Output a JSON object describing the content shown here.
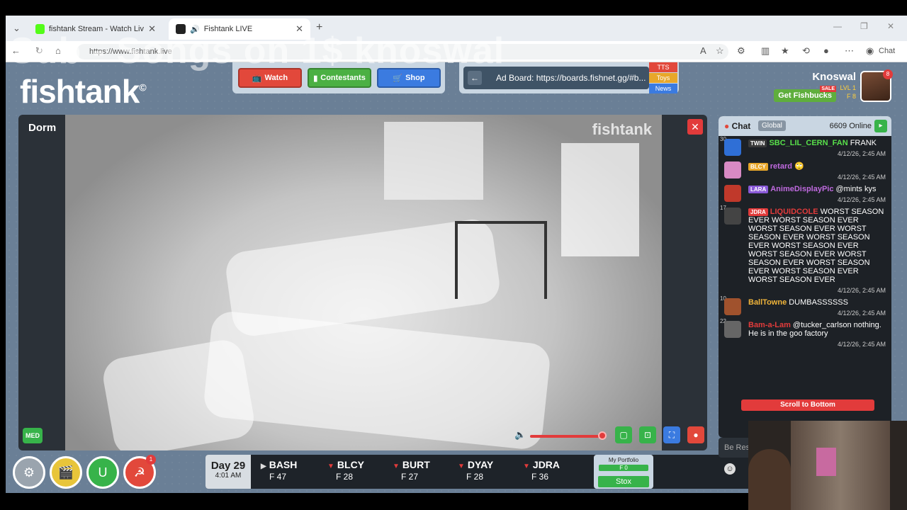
{
  "browser": {
    "tabs": [
      {
        "title": "fishtank Stream - Watch Live on K",
        "favicon_color": "#53fc18",
        "active": false
      },
      {
        "title": "Fishtank LIVE",
        "favicon_color": "#222222",
        "active": true
      }
    ],
    "new_tab_label": "+",
    "url": "https://www.fishtank.live",
    "copilot_label": "Chat"
  },
  "overlay_text": "Sub - Songs on 1$ knoswal",
  "app": {
    "logo": "fishtank",
    "logo_mark": "©",
    "nav": {
      "watch": "Watch",
      "contestants": "Contestants",
      "shop": "Shop"
    },
    "ad_board": "Ad Board: https://boards.fishnet.gg/#b...",
    "ad_tabs": [
      "TTS",
      "Toys",
      "News"
    ],
    "user": {
      "name": "Knoswal",
      "fishbucks_label": "Get Fishbucks",
      "sale_label": "SALE",
      "level": "LVL 1",
      "balance": "F 8",
      "notifications": "8"
    },
    "video": {
      "room": "Dorm",
      "watermark": "fishtank",
      "quality": "MED",
      "close": "✕",
      "volume_level": 0.95
    },
    "bottom_buttons": [
      {
        "name": "settings",
        "color": "#9aa4ae",
        "glyph": "⚙"
      },
      {
        "name": "clapper",
        "color": "#e8c53a",
        "glyph": "🎬"
      },
      {
        "name": "magnet",
        "color": "#37b34a",
        "glyph": "U"
      },
      {
        "name": "hammer-sickle",
        "color": "#e2483b",
        "glyph": "☭",
        "badge": "1"
      }
    ],
    "day": {
      "label": "Day 29",
      "time": "4:01 AM"
    },
    "contestants": [
      {
        "name": "BASH",
        "score": "F 47",
        "trend": "up"
      },
      {
        "name": "BLCY",
        "score": "F 28",
        "trend": "down"
      },
      {
        "name": "BURT",
        "score": "F 27",
        "trend": "down"
      },
      {
        "name": "DYAY",
        "score": "F 28",
        "trend": "down"
      },
      {
        "name": "JDRA",
        "score": "F 36",
        "trend": "down"
      }
    ],
    "portfolio": {
      "title": "My Portfolio",
      "value": "F 0",
      "stox_label": "Stox"
    }
  },
  "chat": {
    "title": "Chat",
    "channel": "Global",
    "online": "6609 Online",
    "scroll_label": "Scroll to Bottom",
    "input_placeholder": "Be Res",
    "messages": [
      {
        "level": "30",
        "badge": "TWIN",
        "badge_color": "#3a3a3a",
        "user": "SBC_LIL_CERN_FAN",
        "user_color": "#58e04a",
        "text": "FRANK",
        "time": "4/12/26, 2:45 AM",
        "avatar_color": "#2f6fd6"
      },
      {
        "level": "",
        "badge": "BLCY",
        "badge_color": "#e8a72a",
        "user": "retard",
        "user_color": "#c06ae0",
        "text": "🙄",
        "time": "4/12/26, 2:45 AM",
        "avatar_color": "#d88ac4"
      },
      {
        "level": "",
        "badge": "LARA",
        "badge_color": "#8a5ad8",
        "user": "AnimeDisplayPic",
        "user_color": "#c06ae0",
        "text": "@mints kys",
        "time": "4/12/26, 2:45 AM",
        "avatar_color": "#c0392b"
      },
      {
        "level": "17",
        "badge": "JDRA",
        "badge_color": "#e23b3b",
        "user": "LIQUIDCOLE",
        "user_color": "#e23b3b",
        "text": "WORST SEASON EVER WORST SEASON EVER WORST SEASON EVER WORST SEASON EVER WORST SEASON EVER WORST SEASON EVER WORST SEASON EVER WORST SEASON EVER WORST SEASON EVER WORST SEASON EVER WORST SEASON EVER",
        "time": "4/12/26, 2:45 AM",
        "avatar_color": "#444444"
      },
      {
        "level": "10",
        "badge": "",
        "badge_color": "",
        "user": "BallTowne",
        "user_color": "#f0b43a",
        "text": "DUMBASSSSSS",
        "time": "4/12/26, 2:45 AM",
        "avatar_color": "#a0522d"
      },
      {
        "level": "22",
        "badge": "",
        "badge_color": "",
        "user": "Bam-a-Lam",
        "user_color": "#e23b3b",
        "text": "@tucker_carlson nothing. He is in the goo factory",
        "time": "4/12/26, 2:45 AM",
        "avatar_color": "#666666"
      }
    ]
  }
}
